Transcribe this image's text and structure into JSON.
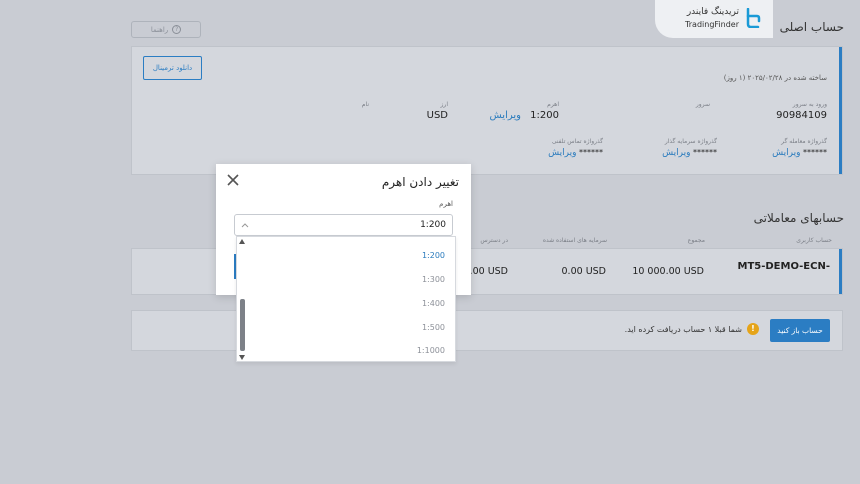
{
  "header": {
    "title": "حساب اصلی",
    "help_label": "راهنما"
  },
  "watermark": {
    "persian": "تریدینگ فایندر",
    "english": "TradingFinder"
  },
  "main_account": {
    "download_label": "دانلود ترمینال",
    "created_text": "ساخته شده در ۲۰۲۵/۰۲/۲۸ (۱ روز)",
    "login_label": "ورود به سرور",
    "login_value": "90984109",
    "server_label": "سرور",
    "leverage_label": "اهرم",
    "leverage_value": "1:200",
    "leverage_edit": "ویرایش",
    "currency_label": "ارز",
    "currency_value": "USD",
    "name_label": "نام",
    "trader_pw_label": "گذرواژه معامله گر",
    "trader_pw_value": "******",
    "trader_pw_edit": "ویرایش",
    "investor_pw_label": "گذرواژه سرمایه گذار",
    "investor_pw_value": "******",
    "investor_pw_edit": "ویرایش",
    "phone_pw_label": "گذرواژه تماس تلفنی",
    "phone_pw_value": "******",
    "phone_pw_edit": "ویرایش"
  },
  "trading_accounts": {
    "title": "حسابهای معاملاتی",
    "columns": [
      "حساب کاربری",
      "مجموع",
      "سرمایه های استفاده شده",
      "در دسترس"
    ],
    "row": {
      "account": "MT5-DEMO-ECN-",
      "total": "10 000.00 USD",
      "used": "0.00 USD",
      "available": "0.00 USD"
    }
  },
  "open_account": {
    "button_label": "حساب باز کنید",
    "notice": "شما قبلا ۱ حساب دریافت کرده اید."
  },
  "modal": {
    "title": "تغییر دادن اهرم",
    "field_label": "اهرم",
    "selected": "1:200",
    "options": [
      "1:200",
      "1:300",
      "1:400",
      "1:500",
      "1:1000"
    ]
  }
}
